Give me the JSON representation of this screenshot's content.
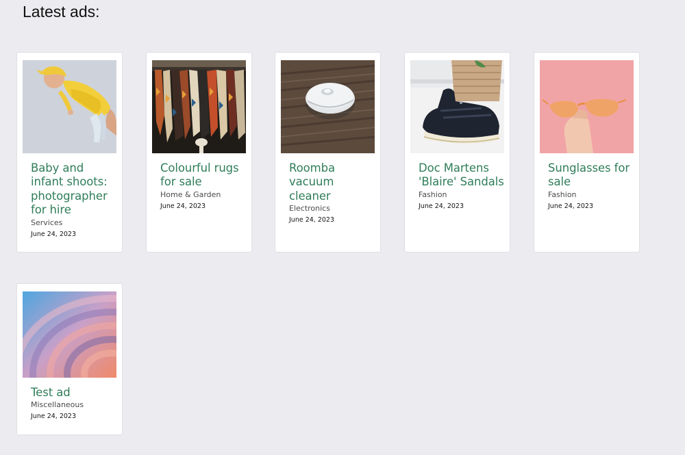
{
  "heading": "Latest ads:",
  "colors": {
    "page_background": "#ebebf0",
    "card_background": "#ffffff",
    "title_color": "#2f7d5a"
  },
  "ads": [
    {
      "title": "Baby and infant shoots: photographer for hire",
      "category": "Services",
      "date": "June 24, 2023",
      "image": "baby-in-yellow-outfit-photo"
    },
    {
      "title": "Colourful rugs for sale",
      "category": "Home & Garden",
      "date": "June 24, 2023",
      "image": "hanging-patterned-rugs-photo"
    },
    {
      "title": "Roomba vacuum cleaner",
      "category": "Electronics",
      "date": "June 24, 2023",
      "image": "robot-vacuum-on-wood-floor-photo"
    },
    {
      "title": "Doc Martens 'Blaire' Sandals",
      "category": "Fashion",
      "date": "June 24, 2023",
      "image": "black-sandals-photo"
    },
    {
      "title": "Sunglasses for sale",
      "category": "Fashion",
      "date": "June 24, 2023",
      "image": "orange-sunglasses-pink-background-photo"
    },
    {
      "title": "Test ad",
      "category": "Miscellaneous",
      "date": "June 24, 2023",
      "image": "abstract-ripple-photo"
    }
  ]
}
